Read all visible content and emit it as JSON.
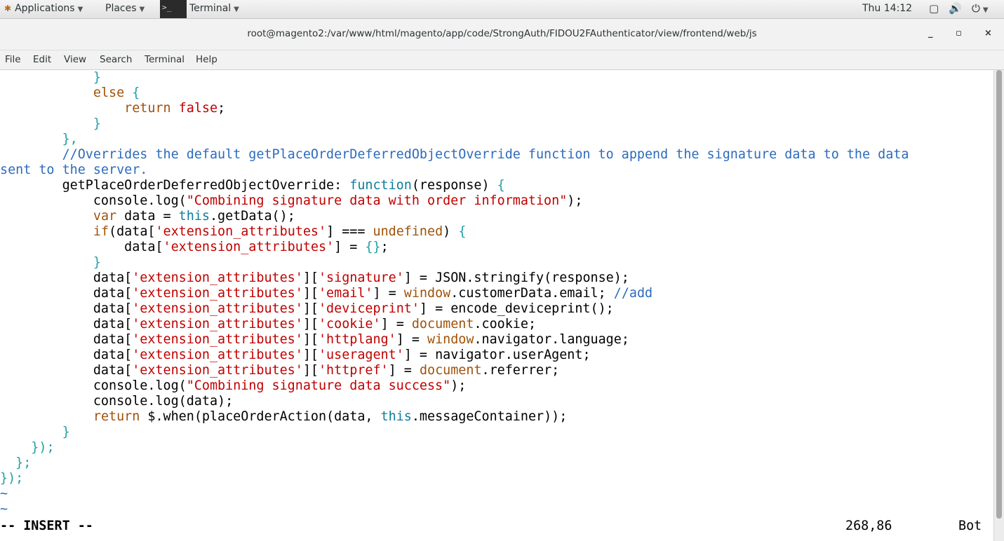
{
  "topbar": {
    "applications": "Applications",
    "places": "Places",
    "terminal": "Terminal",
    "clock": "Thu 14:12"
  },
  "window": {
    "title": "root@magento2:/var/www/html/magento/app/code/StrongAuth/FIDOU2FAuthenticator/view/frontend/web/js",
    "minimize": "_",
    "maximize": "▫",
    "close": "×"
  },
  "menu": [
    "File",
    "Edit",
    "View",
    "Search",
    "Terminal",
    "Help"
  ],
  "editor": {
    "lines": [
      [
        [
          "            }",
          "brace"
        ]
      ],
      [
        [
          "            ",
          ""
        ],
        [
          "else",
          "kw"
        ],
        [
          " ",
          ""
        ],
        [
          "{",
          "brace"
        ]
      ],
      [
        [
          "                ",
          ""
        ],
        [
          "return",
          "kw"
        ],
        [
          " ",
          ""
        ],
        [
          "false",
          "const"
        ],
        [
          ";",
          ""
        ]
      ],
      [
        [
          "            ",
          ""
        ],
        [
          "}",
          "brace"
        ]
      ],
      [
        [
          "        ",
          ""
        ],
        [
          "},",
          "brace"
        ]
      ],
      [
        [
          "        ",
          ""
        ],
        [
          "//Overrides the default getPlaceOrderDeferredObjectOverride function to append the signature data to the data",
          "cmt"
        ]
      ],
      [
        [
          "sent to the server.",
          "cmt"
        ]
      ],
      [
        [
          "        getPlaceOrderDeferredObjectOverride: ",
          ""
        ],
        [
          "function",
          "builtin"
        ],
        [
          "(response) ",
          ""
        ],
        [
          "{",
          "brace"
        ]
      ],
      [
        [
          "            console.log(",
          ""
        ],
        [
          "\"Combining signature data with order information\"",
          "str"
        ],
        [
          ");",
          ""
        ]
      ],
      [
        [
          "            ",
          ""
        ],
        [
          "var",
          "kw"
        ],
        [
          " data = ",
          ""
        ],
        [
          "this",
          "builtin"
        ],
        [
          ".getData();",
          ""
        ]
      ],
      [
        [
          "            ",
          ""
        ],
        [
          "if",
          "kw"
        ],
        [
          "(data[",
          ""
        ],
        [
          "'extension_attributes'",
          "str"
        ],
        [
          "] === ",
          ""
        ],
        [
          "undefined",
          "kw"
        ],
        [
          ") ",
          ""
        ],
        [
          "{",
          "brace"
        ]
      ],
      [
        [
          "                data[",
          ""
        ],
        [
          "'extension_attributes'",
          "str"
        ],
        [
          "] = ",
          ""
        ],
        [
          "{}",
          "brace"
        ],
        [
          ";",
          ""
        ]
      ],
      [
        [
          "            ",
          ""
        ],
        [
          "}",
          "brace"
        ]
      ],
      [
        [
          "            data[",
          ""
        ],
        [
          "'extension_attributes'",
          "str"
        ],
        [
          "][",
          ""
        ],
        [
          "'signature'",
          "str"
        ],
        [
          "] = JSON.stringify(response);",
          ""
        ]
      ],
      [
        [
          "            data[",
          ""
        ],
        [
          "'extension_attributes'",
          "str"
        ],
        [
          "][",
          ""
        ],
        [
          "'email'",
          "str"
        ],
        [
          "] = ",
          ""
        ],
        [
          "window",
          "kw"
        ],
        [
          ".customerData.email; ",
          ""
        ],
        [
          "//add",
          "cmt"
        ]
      ],
      [
        [
          "            data[",
          ""
        ],
        [
          "'extension_attributes'",
          "str"
        ],
        [
          "][",
          ""
        ],
        [
          "'deviceprint'",
          "str"
        ],
        [
          "] = encode_deviceprint();",
          ""
        ]
      ],
      [
        [
          "            data[",
          ""
        ],
        [
          "'extension_attributes'",
          "str"
        ],
        [
          "][",
          ""
        ],
        [
          "'cookie'",
          "str"
        ],
        [
          "] = ",
          ""
        ],
        [
          "document",
          "kw"
        ],
        [
          ".cookie;",
          ""
        ]
      ],
      [
        [
          "            data[",
          ""
        ],
        [
          "'extension_attributes'",
          "str"
        ],
        [
          "][",
          ""
        ],
        [
          "'httplang'",
          "str"
        ],
        [
          "] = ",
          ""
        ],
        [
          "window",
          "kw"
        ],
        [
          ".navigator.language;",
          ""
        ]
      ],
      [
        [
          "            data[",
          ""
        ],
        [
          "'extension_attributes'",
          "str"
        ],
        [
          "][",
          ""
        ],
        [
          "'useragent'",
          "str"
        ],
        [
          "] = navigator.userAgent;",
          ""
        ]
      ],
      [
        [
          "            data[",
          ""
        ],
        [
          "'extension_attributes'",
          "str"
        ],
        [
          "][",
          ""
        ],
        [
          "'httpref'",
          "str"
        ],
        [
          "] = ",
          ""
        ],
        [
          "document",
          "kw"
        ],
        [
          ".referrer;",
          ""
        ]
      ],
      [
        [
          "            console.log(",
          ""
        ],
        [
          "\"Combining signature data success\"",
          "str"
        ],
        [
          ");",
          ""
        ]
      ],
      [
        [
          "            console.log(data);",
          ""
        ]
      ],
      [
        [
          "            ",
          ""
        ],
        [
          "return",
          "kw"
        ],
        [
          " $.when(placeOrderAction(data, ",
          ""
        ],
        [
          "this",
          "builtin"
        ],
        [
          ".messageContainer));",
          ""
        ]
      ],
      [
        [
          "        ",
          ""
        ],
        [
          "}",
          "brace"
        ]
      ],
      [
        [
          "    ",
          ""
        ],
        [
          "});",
          "brace"
        ]
      ],
      [
        [
          "  ",
          ""
        ],
        [
          "};",
          "brace"
        ]
      ],
      [
        [
          "});",
          "brace"
        ]
      ],
      [
        [
          "~",
          "tilde"
        ]
      ],
      [
        [
          "~",
          "tilde"
        ]
      ]
    ],
    "mode": "-- INSERT --",
    "position": "268,86",
    "scroll": "Bot"
  },
  "colors": {
    "keyword": "#a0520a",
    "string": "#c00000",
    "brace": "#1fa0a6",
    "comment": "#2c6bbd",
    "builtin": "#0d7d9c"
  }
}
